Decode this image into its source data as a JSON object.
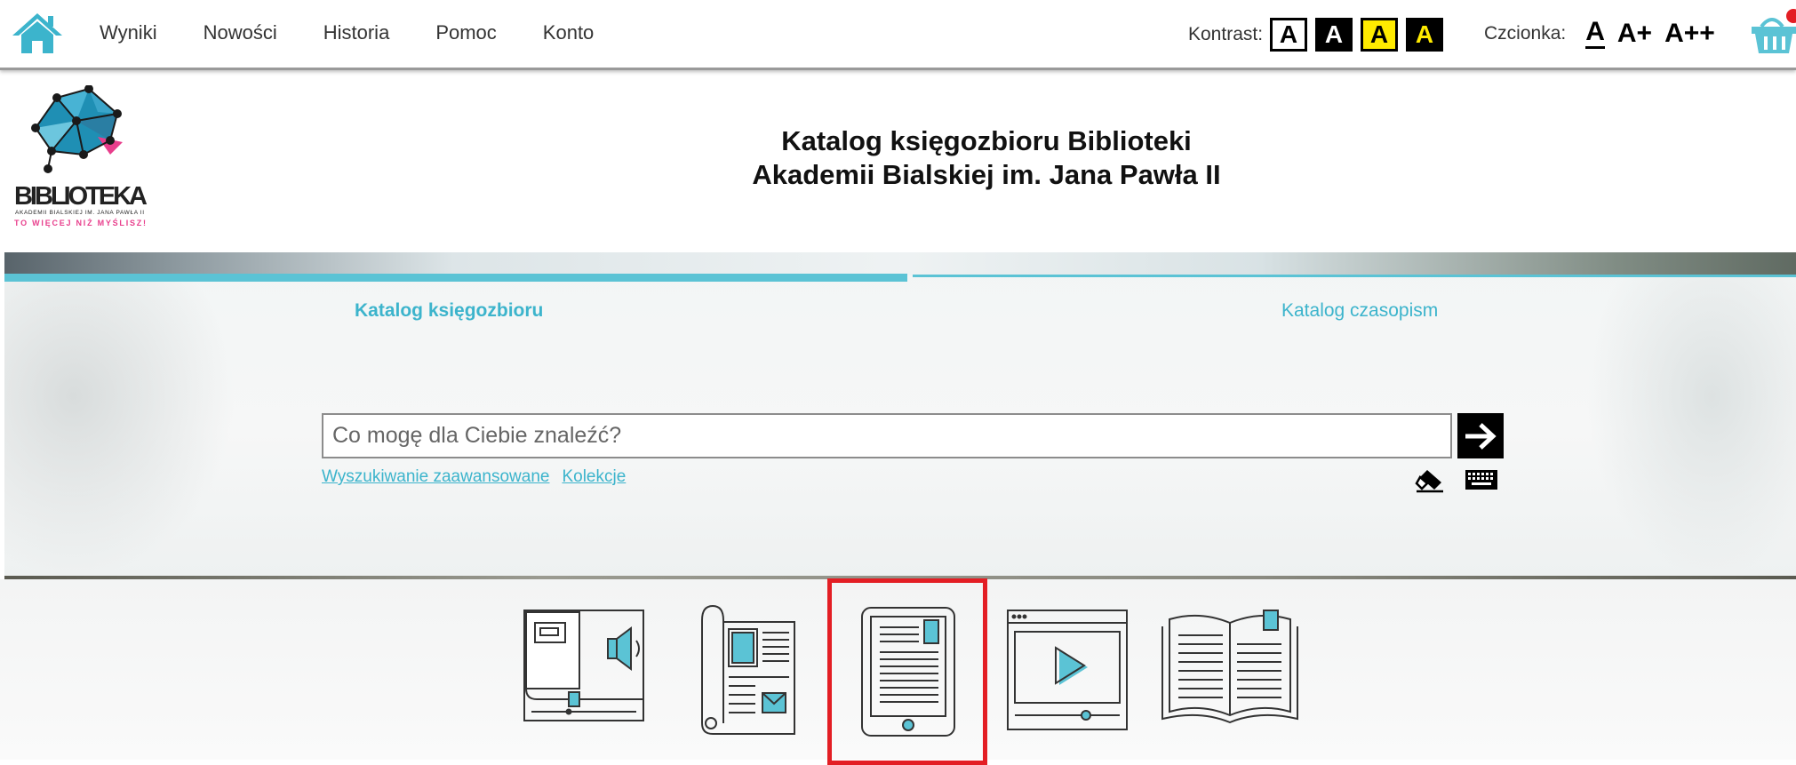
{
  "nav": {
    "home_icon": "home-icon",
    "items": [
      "Wyniki",
      "Nowości",
      "Historia",
      "Pomoc",
      "Konto"
    ]
  },
  "accessibility": {
    "contrast_label": "Kontrast:",
    "contrast_options": [
      "A",
      "A",
      "A",
      "A"
    ],
    "font_label": "Czcionka:",
    "font_options": [
      "A",
      "A+",
      "A++"
    ]
  },
  "logo": {
    "name": "BIBLIOTEKA",
    "subtitle": "AKADEMII BIALSKIEJ IM. JANA PAWŁA II",
    "tagline": "TO WIĘCEJ NIŻ MYŚLISZ!"
  },
  "header": {
    "title_line1": "Katalog księgozbioru Biblioteki",
    "title_line2": "Akademii Bialskiej im. Jana Pawła II"
  },
  "tabs": {
    "active": "Katalog księgozbioru",
    "inactive": "Katalog czasopism"
  },
  "search": {
    "placeholder": "Co mogę dla Ciebie znaleźć?",
    "advanced_link": "Wyszukiwanie zaawansowane",
    "collections_link": "Kolekcje"
  },
  "resource_types": [
    "audiobook-icon",
    "magazine-icon",
    "ebook-icon",
    "video-icon",
    "book-icon"
  ],
  "colors": {
    "accent": "#5bc3d5",
    "link": "#3cb4cc",
    "highlight": "#e31e24",
    "contrast_yellow": "#ffeb00",
    "basket": "#5bc3d5"
  }
}
